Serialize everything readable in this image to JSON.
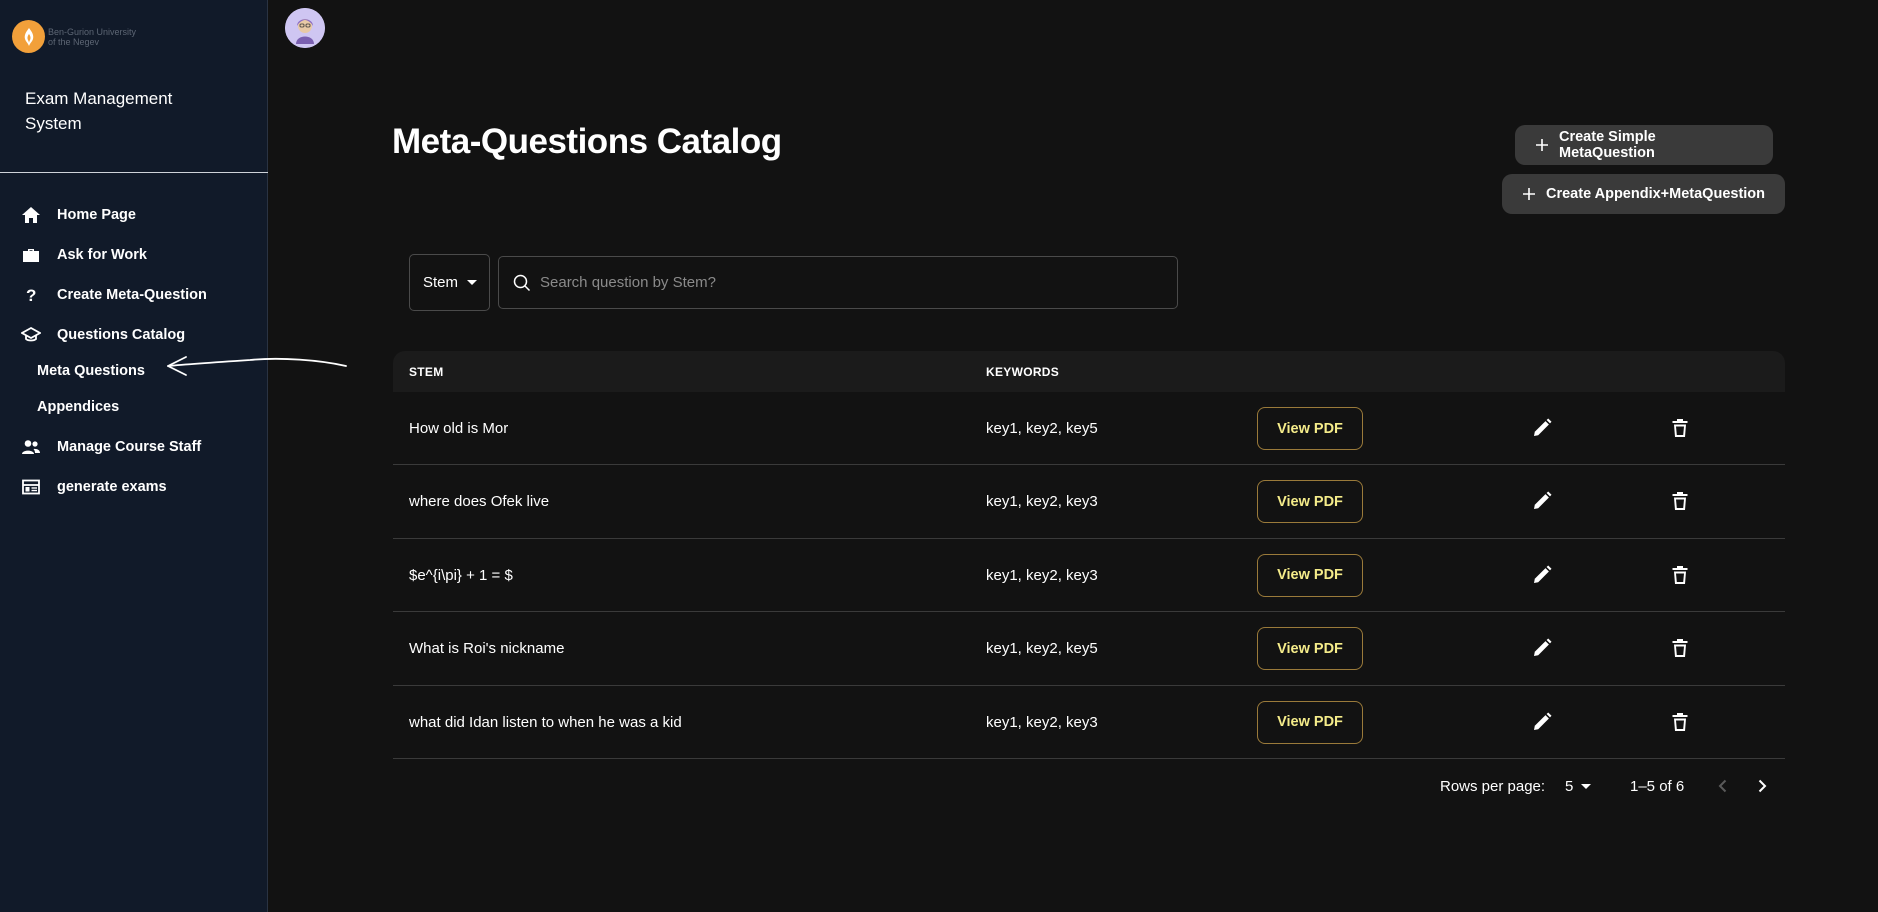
{
  "sidebar": {
    "logo": {
      "line1": "Ben-Gurion University",
      "line2": "of the Negev"
    },
    "app_title": "Exam Management System",
    "items": [
      {
        "label": "Home Page",
        "icon": "home-icon"
      },
      {
        "label": "Ask for Work",
        "icon": "briefcase-icon"
      },
      {
        "label": "Create Meta-Question",
        "icon": "question-mark-icon"
      },
      {
        "label": "Questions Catalog",
        "icon": "graduation-cap-icon"
      },
      {
        "label": "Manage Course Staff",
        "icon": "people-icon"
      },
      {
        "label": "generate exams",
        "icon": "table-layout-icon"
      }
    ],
    "sub_items": [
      {
        "label": "Meta Questions"
      },
      {
        "label": "Appendices"
      }
    ]
  },
  "header": {
    "avatar_icon": "user-avatar"
  },
  "main": {
    "title": "Meta-Questions Catalog",
    "create_simple_label": "Create Simple MetaQuestion",
    "create_appendix_label": "Create Appendix+MetaQuestion",
    "filter": {
      "selected": "Stem"
    },
    "search": {
      "placeholder": "Search question by Stem?",
      "value": ""
    }
  },
  "table": {
    "columns": [
      "STEM",
      "KEYWORDS"
    ],
    "rows": [
      {
        "stem": "How old is Mor",
        "keywords": "key1, key2, key5",
        "action": "View PDF"
      },
      {
        "stem": "where does Ofek live",
        "keywords": "key1, key2, key3",
        "action": "View PDF"
      },
      {
        "stem": "$e^{i\\pi} + 1 = $",
        "keywords": "key1, key2, key3",
        "action": "View PDF"
      },
      {
        "stem": "What is Roi's nickname",
        "keywords": "key1, key2, key5",
        "action": "View PDF"
      },
      {
        "stem": "what did Idan listen to when he was a kid",
        "keywords": "key1, key2, key3",
        "action": "View PDF"
      }
    ]
  },
  "pagination": {
    "rows_per_page_label": "Rows per page:",
    "rows_per_page": "5",
    "range": "1–5 of 6"
  },
  "colors": {
    "background": "#121212",
    "sidebar": "#111a29",
    "accent_text": "#f5ec8a",
    "accent_border": "#9a7a3a",
    "button_bg": "#3a3a3a",
    "logo": "#f2a03a"
  }
}
